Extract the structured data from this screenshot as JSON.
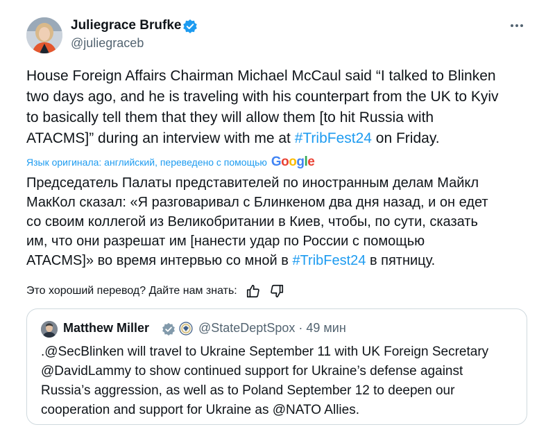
{
  "author": {
    "name": "Juliegrace Brufke",
    "handle": "@juliegraceb"
  },
  "tweet": {
    "text_part1": "House Foreign Affairs Chairman Michael McCaul said “I talked to Blinken\ntwo days ago, and he is traveling with his counterpart from the UK to Kyiv\nto basically tell them that they will allow them [to hit Russia with\nATACMS]” during an interview with me at ",
    "hashtag": "#TribFest24",
    "text_part2": " on Friday."
  },
  "translation": {
    "note": "Язык оригинала: английский, переведено с помощью",
    "provider": "Google",
    "text_part1": "Председатель Палаты представителей по иностранным делам Майкл\nМакКол сказал: «Я разговаривал с Блинкеном два дня назад, и он едет\nсо своим коллегой из Великобритании в Киев, чтобы, по сути, сказать\nим, что они разрешат им [нанести удар по России с помощью\nATACMS]» во время интервью со мной в ",
    "hashtag": "#TribFest24",
    "text_part2": " в пятницу.",
    "feedback_prompt": "Это хороший перевод? Дайте нам знать:"
  },
  "quote": {
    "name": "Matthew Miller",
    "handle": "@StateDeptSpox",
    "time": "· 49 мин",
    "text": ".@SecBlinken will travel to Ukraine September 11 with UK Foreign Secretary\n@DavidLammy to show continued support for Ukraine’s defense against\nRussia’s aggression, as well as to Poland September 12 to deepen our\ncooperation and support for Ukraine as @NATO Allies."
  },
  "colors": {
    "accent": "#1d9bf0",
    "text": "#0f1419",
    "secondary": "#536471",
    "border": "#cfd9de",
    "gov_badge": "#829aab"
  }
}
